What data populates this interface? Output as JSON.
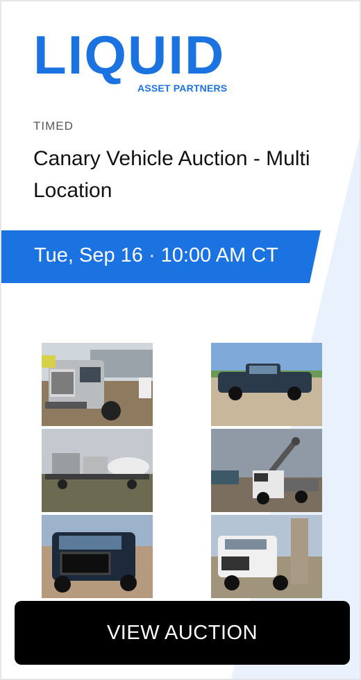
{
  "brand": {
    "name": "LIQUID",
    "tagline": "ASSET PARTNERS",
    "color": "#1a73e0"
  },
  "auction": {
    "type": "TIMED",
    "title": "Canary Vehicle Auction - Multi Location",
    "date": "Tue, Sep 16 · 10:00 AM CT"
  },
  "photos": [
    {
      "icon": "semi-truck-photo"
    },
    {
      "icon": "pickup-truck-photo"
    },
    {
      "icon": "equipment-trailer-photo"
    },
    {
      "icon": "boom-truck-photo"
    },
    {
      "icon": "pickup-truck-grille-guard-photo"
    },
    {
      "icon": "crane-truck-photo"
    }
  ],
  "cta": {
    "label": "VIEW AUCTION"
  }
}
